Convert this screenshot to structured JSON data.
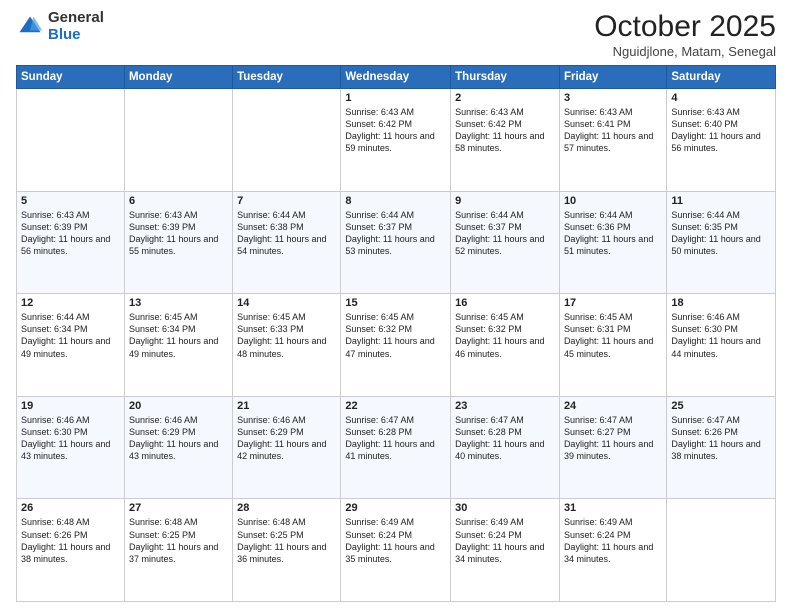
{
  "logo": {
    "general": "General",
    "blue": "Blue"
  },
  "title": "October 2025",
  "location": "Nguidjlone, Matam, Senegal",
  "weekdays": [
    "Sunday",
    "Monday",
    "Tuesday",
    "Wednesday",
    "Thursday",
    "Friday",
    "Saturday"
  ],
  "weeks": [
    [
      {
        "day": "",
        "sunrise": "",
        "sunset": "",
        "daylight": ""
      },
      {
        "day": "",
        "sunrise": "",
        "sunset": "",
        "daylight": ""
      },
      {
        "day": "",
        "sunrise": "",
        "sunset": "",
        "daylight": ""
      },
      {
        "day": "1",
        "sunrise": "Sunrise: 6:43 AM",
        "sunset": "Sunset: 6:42 PM",
        "daylight": "Daylight: 11 hours and 59 minutes."
      },
      {
        "day": "2",
        "sunrise": "Sunrise: 6:43 AM",
        "sunset": "Sunset: 6:42 PM",
        "daylight": "Daylight: 11 hours and 58 minutes."
      },
      {
        "day": "3",
        "sunrise": "Sunrise: 6:43 AM",
        "sunset": "Sunset: 6:41 PM",
        "daylight": "Daylight: 11 hours and 57 minutes."
      },
      {
        "day": "4",
        "sunrise": "Sunrise: 6:43 AM",
        "sunset": "Sunset: 6:40 PM",
        "daylight": "Daylight: 11 hours and 56 minutes."
      }
    ],
    [
      {
        "day": "5",
        "sunrise": "Sunrise: 6:43 AM",
        "sunset": "Sunset: 6:39 PM",
        "daylight": "Daylight: 11 hours and 56 minutes."
      },
      {
        "day": "6",
        "sunrise": "Sunrise: 6:43 AM",
        "sunset": "Sunset: 6:39 PM",
        "daylight": "Daylight: 11 hours and 55 minutes."
      },
      {
        "day": "7",
        "sunrise": "Sunrise: 6:44 AM",
        "sunset": "Sunset: 6:38 PM",
        "daylight": "Daylight: 11 hours and 54 minutes."
      },
      {
        "day": "8",
        "sunrise": "Sunrise: 6:44 AM",
        "sunset": "Sunset: 6:37 PM",
        "daylight": "Daylight: 11 hours and 53 minutes."
      },
      {
        "day": "9",
        "sunrise": "Sunrise: 6:44 AM",
        "sunset": "Sunset: 6:37 PM",
        "daylight": "Daylight: 11 hours and 52 minutes."
      },
      {
        "day": "10",
        "sunrise": "Sunrise: 6:44 AM",
        "sunset": "Sunset: 6:36 PM",
        "daylight": "Daylight: 11 hours and 51 minutes."
      },
      {
        "day": "11",
        "sunrise": "Sunrise: 6:44 AM",
        "sunset": "Sunset: 6:35 PM",
        "daylight": "Daylight: 11 hours and 50 minutes."
      }
    ],
    [
      {
        "day": "12",
        "sunrise": "Sunrise: 6:44 AM",
        "sunset": "Sunset: 6:34 PM",
        "daylight": "Daylight: 11 hours and 49 minutes."
      },
      {
        "day": "13",
        "sunrise": "Sunrise: 6:45 AM",
        "sunset": "Sunset: 6:34 PM",
        "daylight": "Daylight: 11 hours and 49 minutes."
      },
      {
        "day": "14",
        "sunrise": "Sunrise: 6:45 AM",
        "sunset": "Sunset: 6:33 PM",
        "daylight": "Daylight: 11 hours and 48 minutes."
      },
      {
        "day": "15",
        "sunrise": "Sunrise: 6:45 AM",
        "sunset": "Sunset: 6:32 PM",
        "daylight": "Daylight: 11 hours and 47 minutes."
      },
      {
        "day": "16",
        "sunrise": "Sunrise: 6:45 AM",
        "sunset": "Sunset: 6:32 PM",
        "daylight": "Daylight: 11 hours and 46 minutes."
      },
      {
        "day": "17",
        "sunrise": "Sunrise: 6:45 AM",
        "sunset": "Sunset: 6:31 PM",
        "daylight": "Daylight: 11 hours and 45 minutes."
      },
      {
        "day": "18",
        "sunrise": "Sunrise: 6:46 AM",
        "sunset": "Sunset: 6:30 PM",
        "daylight": "Daylight: 11 hours and 44 minutes."
      }
    ],
    [
      {
        "day": "19",
        "sunrise": "Sunrise: 6:46 AM",
        "sunset": "Sunset: 6:30 PM",
        "daylight": "Daylight: 11 hours and 43 minutes."
      },
      {
        "day": "20",
        "sunrise": "Sunrise: 6:46 AM",
        "sunset": "Sunset: 6:29 PM",
        "daylight": "Daylight: 11 hours and 43 minutes."
      },
      {
        "day": "21",
        "sunrise": "Sunrise: 6:46 AM",
        "sunset": "Sunset: 6:29 PM",
        "daylight": "Daylight: 11 hours and 42 minutes."
      },
      {
        "day": "22",
        "sunrise": "Sunrise: 6:47 AM",
        "sunset": "Sunset: 6:28 PM",
        "daylight": "Daylight: 11 hours and 41 minutes."
      },
      {
        "day": "23",
        "sunrise": "Sunrise: 6:47 AM",
        "sunset": "Sunset: 6:28 PM",
        "daylight": "Daylight: 11 hours and 40 minutes."
      },
      {
        "day": "24",
        "sunrise": "Sunrise: 6:47 AM",
        "sunset": "Sunset: 6:27 PM",
        "daylight": "Daylight: 11 hours and 39 minutes."
      },
      {
        "day": "25",
        "sunrise": "Sunrise: 6:47 AM",
        "sunset": "Sunset: 6:26 PM",
        "daylight": "Daylight: 11 hours and 38 minutes."
      }
    ],
    [
      {
        "day": "26",
        "sunrise": "Sunrise: 6:48 AM",
        "sunset": "Sunset: 6:26 PM",
        "daylight": "Daylight: 11 hours and 38 minutes."
      },
      {
        "day": "27",
        "sunrise": "Sunrise: 6:48 AM",
        "sunset": "Sunset: 6:25 PM",
        "daylight": "Daylight: 11 hours and 37 minutes."
      },
      {
        "day": "28",
        "sunrise": "Sunrise: 6:48 AM",
        "sunset": "Sunset: 6:25 PM",
        "daylight": "Daylight: 11 hours and 36 minutes."
      },
      {
        "day": "29",
        "sunrise": "Sunrise: 6:49 AM",
        "sunset": "Sunset: 6:24 PM",
        "daylight": "Daylight: 11 hours and 35 minutes."
      },
      {
        "day": "30",
        "sunrise": "Sunrise: 6:49 AM",
        "sunset": "Sunset: 6:24 PM",
        "daylight": "Daylight: 11 hours and 34 minutes."
      },
      {
        "day": "31",
        "sunrise": "Sunrise: 6:49 AM",
        "sunset": "Sunset: 6:24 PM",
        "daylight": "Daylight: 11 hours and 34 minutes."
      },
      {
        "day": "",
        "sunrise": "",
        "sunset": "",
        "daylight": ""
      }
    ]
  ]
}
